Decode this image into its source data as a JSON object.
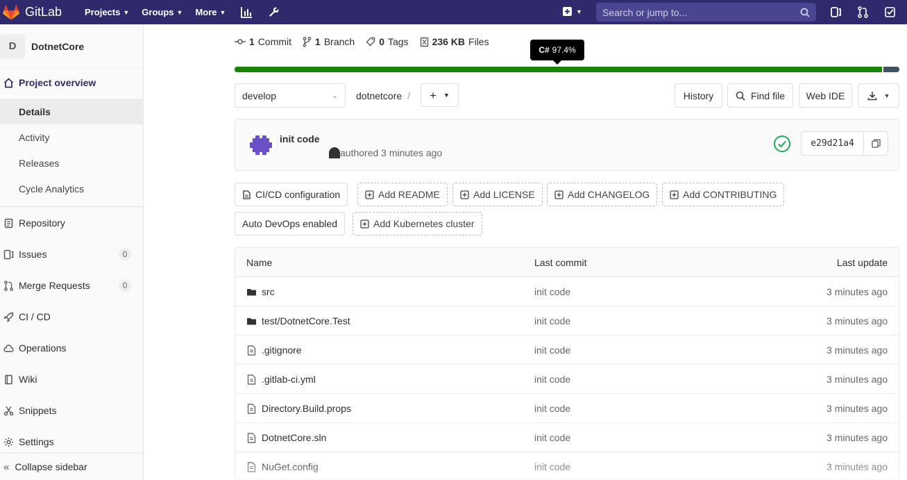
{
  "topbar": {
    "brand": "GitLab",
    "nav": [
      {
        "label": "Projects",
        "dropdown": true
      },
      {
        "label": "Groups",
        "dropdown": true
      },
      {
        "label": "More",
        "dropdown": true
      }
    ],
    "search_placeholder": "Search or jump to...",
    "bg_color": "#2f2a6b"
  },
  "sidebar": {
    "project_initial": "D",
    "project_name": "DotnetCore",
    "overview_label": "Project overview",
    "sub_items": [
      "Details",
      "Activity",
      "Releases",
      "Cycle Analytics"
    ],
    "items": [
      {
        "label": "Repository",
        "icon": "doc-icon"
      },
      {
        "label": "Issues",
        "icon": "issues-icon",
        "badge": "0"
      },
      {
        "label": "Merge Requests",
        "icon": "merge-icon",
        "badge": "0"
      },
      {
        "label": "CI / CD",
        "icon": "rocket-icon"
      },
      {
        "label": "Operations",
        "icon": "cloud-icon"
      },
      {
        "label": "Wiki",
        "icon": "book-icon"
      },
      {
        "label": "Snippets",
        "icon": "scissors-icon"
      },
      {
        "label": "Settings",
        "icon": "gear-icon"
      }
    ],
    "collapse_label": "Collapse sidebar"
  },
  "stats": {
    "commits_count": "1",
    "commits_label": "Commit",
    "branches_count": "1",
    "branches_label": "Branch",
    "tags_count": "0",
    "tags_label": "Tags",
    "files_size": "236 KB",
    "files_label": "Files"
  },
  "language_tooltip": {
    "lang": "C#",
    "percent": "97.4%"
  },
  "language_bar": [
    {
      "name": "C#",
      "fraction": 0.974,
      "color": "#178600"
    },
    {
      "name": "other",
      "fraction": 0.026,
      "color": "#3f5460"
    }
  ],
  "repo_bar": {
    "branch": "develop",
    "path": "dotnetcore",
    "path_sep": "/",
    "history_label": "History",
    "find_file_label": "Find file",
    "web_ide_label": "Web IDE"
  },
  "commit": {
    "title": "init code",
    "meta": "authored 3 minutes ago",
    "sha": "e29d21a4",
    "status_color": "#1aaa55"
  },
  "quick_actions": {
    "row1": [
      {
        "label": "CI/CD configuration",
        "style": "solid",
        "icon": "file-icon"
      },
      {
        "label": "Add README",
        "style": "dashed",
        "icon": "plus-square-icon"
      },
      {
        "label": "Add LICENSE",
        "style": "dashed",
        "icon": "plus-square-icon"
      },
      {
        "label": "Add CHANGELOG",
        "style": "dashed",
        "icon": "plus-square-icon"
      },
      {
        "label": "Add CONTRIBUTING",
        "style": "dashed",
        "icon": "plus-square-icon"
      }
    ],
    "row2": [
      {
        "label": "Auto DevOps enabled",
        "style": "solid"
      },
      {
        "label": "Add Kubernetes cluster",
        "style": "dashed",
        "icon": "plus-square-icon"
      }
    ]
  },
  "tree": {
    "headers": {
      "name": "Name",
      "last_commit": "Last commit",
      "last_update": "Last update"
    },
    "rows": [
      {
        "name": "src",
        "type": "folder",
        "commit": "init code",
        "updated": "3 minutes ago"
      },
      {
        "name": "test/DotnetCore.Test",
        "type": "folder",
        "commit": "init code",
        "updated": "3 minutes ago"
      },
      {
        "name": ".gitignore",
        "type": "file",
        "commit": "init code",
        "updated": "3 minutes ago"
      },
      {
        "name": ".gitlab-ci.yml",
        "type": "file",
        "commit": "init code",
        "updated": "3 minutes ago"
      },
      {
        "name": "Directory.Build.props",
        "type": "file",
        "commit": "init code",
        "updated": "3 minutes ago"
      },
      {
        "name": "DotnetCore.sln",
        "type": "file",
        "commit": "init code",
        "updated": "3 minutes ago"
      },
      {
        "name": "NuGet.config",
        "type": "file",
        "commit": "init code",
        "updated": "3 minutes ago"
      }
    ]
  }
}
